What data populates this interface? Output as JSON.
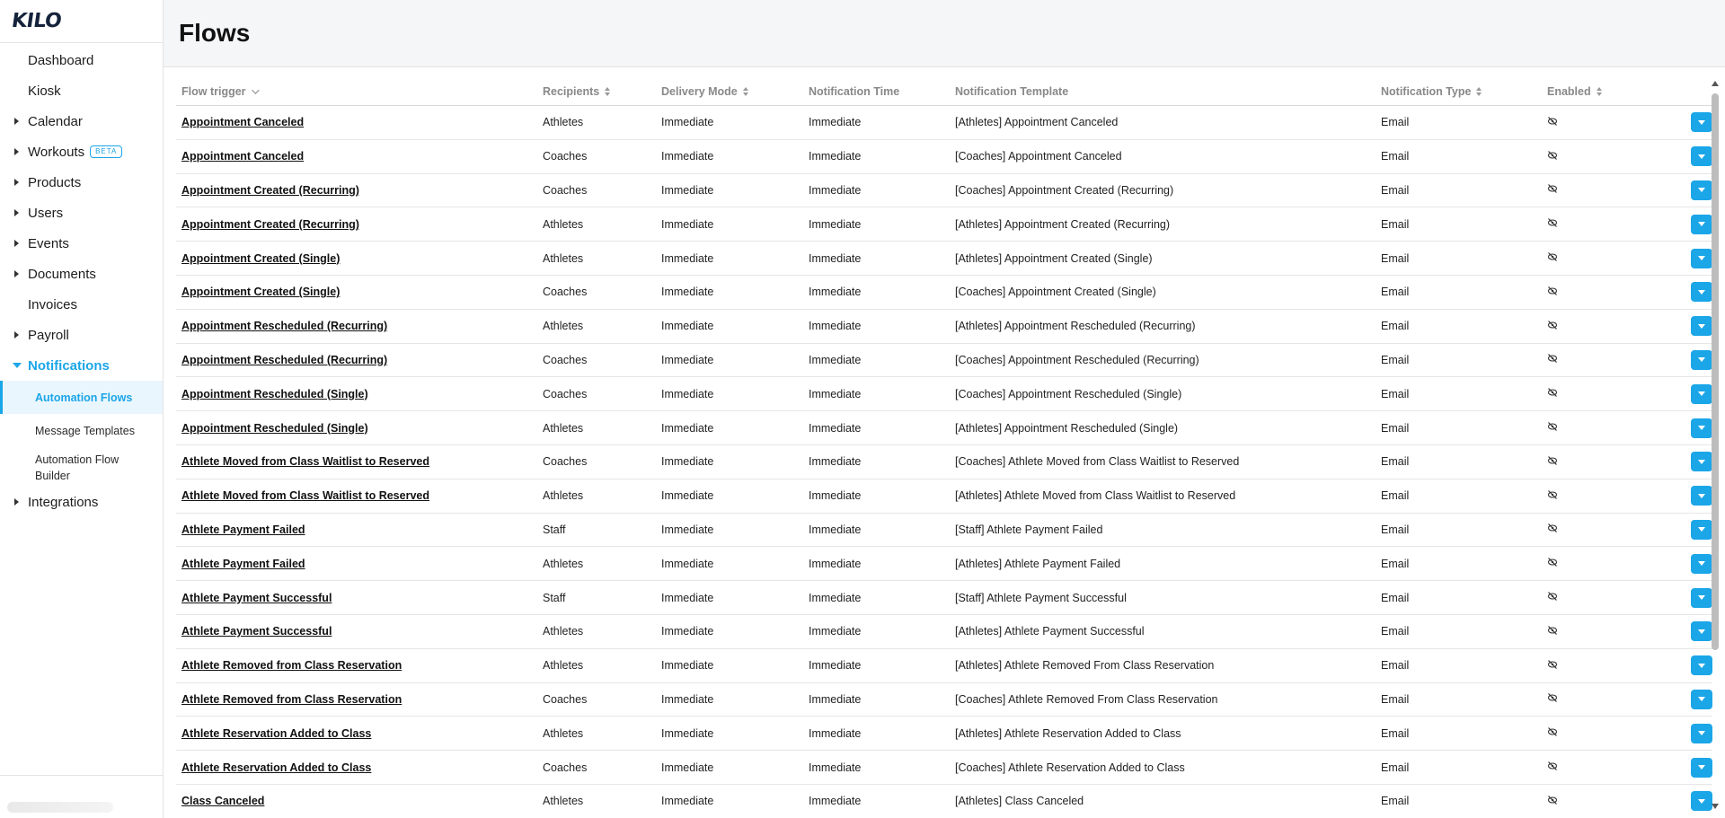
{
  "brand": {
    "logo_text": "KILO",
    "accent": "#1ba6e8"
  },
  "sidebar": {
    "items": [
      {
        "label": "Dashboard",
        "has_caret": false
      },
      {
        "label": "Kiosk",
        "has_caret": false
      },
      {
        "label": "Calendar",
        "has_caret": true
      },
      {
        "label": "Workouts",
        "has_caret": true,
        "badge": "BETA"
      },
      {
        "label": "Products",
        "has_caret": true
      },
      {
        "label": "Users",
        "has_caret": true
      },
      {
        "label": "Events",
        "has_caret": true
      },
      {
        "label": "Documents",
        "has_caret": true
      },
      {
        "label": "Invoices",
        "has_caret": false
      },
      {
        "label": "Payroll",
        "has_caret": true
      },
      {
        "label": "Notifications",
        "has_caret": true,
        "open": true
      }
    ],
    "sub_items": [
      {
        "label": "Automation Flows",
        "active": true
      },
      {
        "label": "Message Templates",
        "active": false
      },
      {
        "label": "Automation Flow Builder",
        "active": false
      }
    ],
    "after_items": [
      {
        "label": "Integrations",
        "has_caret": true
      }
    ]
  },
  "page": {
    "title": "Flows"
  },
  "table": {
    "headers": {
      "flow_trigger": "Flow trigger",
      "recipients": "Recipients",
      "delivery_mode": "Delivery Mode",
      "notification_time": "Notification Time",
      "notification_template": "Notification Template",
      "notification_type": "Notification Type",
      "enabled": "Enabled"
    },
    "rows": [
      [
        "Appointment Canceled",
        "Athletes",
        "Immediate",
        "Immediate",
        "[Athletes] Appointment Canceled",
        "Email"
      ],
      [
        "Appointment Canceled",
        "Coaches",
        "Immediate",
        "Immediate",
        "[Coaches] Appointment Canceled",
        "Email"
      ],
      [
        "Appointment Created (Recurring)",
        "Coaches",
        "Immediate",
        "Immediate",
        "[Coaches] Appointment Created (Recurring)",
        "Email"
      ],
      [
        "Appointment Created (Recurring)",
        "Athletes",
        "Immediate",
        "Immediate",
        "[Athletes] Appointment Created (Recurring)",
        "Email"
      ],
      [
        "Appointment Created (Single)",
        "Athletes",
        "Immediate",
        "Immediate",
        "[Athletes] Appointment Created (Single)",
        "Email"
      ],
      [
        "Appointment Created (Single)",
        "Coaches",
        "Immediate",
        "Immediate",
        "[Coaches] Appointment Created (Single)",
        "Email"
      ],
      [
        "Appointment Rescheduled (Recurring)",
        "Athletes",
        "Immediate",
        "Immediate",
        "[Athletes] Appointment Rescheduled (Recurring)",
        "Email"
      ],
      [
        "Appointment Rescheduled (Recurring)",
        "Coaches",
        "Immediate",
        "Immediate",
        "[Coaches] Appointment Rescheduled (Recurring)",
        "Email"
      ],
      [
        "Appointment Rescheduled (Single)",
        "Coaches",
        "Immediate",
        "Immediate",
        "[Coaches] Appointment Rescheduled (Single)",
        "Email"
      ],
      [
        "Appointment Rescheduled (Single)",
        "Athletes",
        "Immediate",
        "Immediate",
        "[Athletes] Appointment Rescheduled (Single)",
        "Email"
      ],
      [
        "Athlete Moved from Class Waitlist to Reserved",
        "Coaches",
        "Immediate",
        "Immediate",
        "[Coaches] Athlete Moved from Class Waitlist to Reserved",
        "Email"
      ],
      [
        "Athlete Moved from Class Waitlist to Reserved",
        "Athletes",
        "Immediate",
        "Immediate",
        "[Athletes] Athlete Moved from Class Waitlist to Reserved",
        "Email"
      ],
      [
        "Athlete Payment Failed",
        "Staff",
        "Immediate",
        "Immediate",
        "[Staff] Athlete Payment Failed",
        "Email"
      ],
      [
        "Athlete Payment Failed",
        "Athletes",
        "Immediate",
        "Immediate",
        "[Athletes] Athlete Payment Failed",
        "Email"
      ],
      [
        "Athlete Payment Successful",
        "Staff",
        "Immediate",
        "Immediate",
        "[Staff] Athlete Payment Successful",
        "Email"
      ],
      [
        "Athlete Payment Successful",
        "Athletes",
        "Immediate",
        "Immediate",
        "[Athletes] Athlete Payment Successful",
        "Email"
      ],
      [
        "Athlete Removed from Class Reservation",
        "Athletes",
        "Immediate",
        "Immediate",
        "[Athletes] Athlete Removed From Class Reservation",
        "Email"
      ],
      [
        "Athlete Removed from Class Reservation",
        "Coaches",
        "Immediate",
        "Immediate",
        "[Coaches] Athlete Removed From Class Reservation",
        "Email"
      ],
      [
        "Athlete Reservation Added to Class",
        "Athletes",
        "Immediate",
        "Immediate",
        "[Athletes] Athlete Reservation Added to Class",
        "Email"
      ],
      [
        "Athlete Reservation Added to Class",
        "Coaches",
        "Immediate",
        "Immediate",
        "[Coaches] Athlete Reservation Added to Class",
        "Email"
      ],
      [
        "Class Canceled",
        "Athletes",
        "Immediate",
        "Immediate",
        "[Athletes] Class Canceled",
        "Email"
      ]
    ],
    "enabled_icon": "eye-slash-icon",
    "action_icon": "caret-down-icon"
  }
}
